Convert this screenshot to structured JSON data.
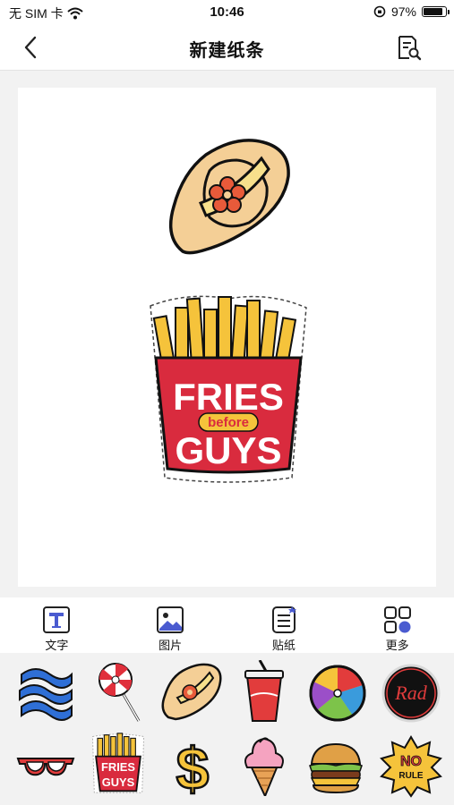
{
  "status_bar": {
    "carrier": "无 SIM 卡",
    "time": "10:46",
    "battery": "97%",
    "battery_level": 0.97
  },
  "nav": {
    "title": "新建纸条",
    "back_icon": "chevron-left-icon",
    "action_icon": "document-search-icon"
  },
  "canvas": {
    "items": [
      "hat-sticker",
      "fries-before-guys-sticker"
    ],
    "fries_text": {
      "line1": "FRIES",
      "line2": "before",
      "line3": "GUYS"
    }
  },
  "toolbar": {
    "text_label": "文字",
    "image_label": "图片",
    "sticker_label": "贴纸",
    "more_label": "更多",
    "accent": "#4a5bd0"
  },
  "stickers": {
    "row1": [
      "waves",
      "lollipop",
      "hat",
      "soda-cup",
      "beach-ball",
      "rad-badge"
    ],
    "row2": [
      "sunglasses",
      "fries",
      "dollar-sign",
      "ice-cream",
      "burger",
      "no-rule-badge"
    ],
    "rad_text": "Rad",
    "fries_text": {
      "line1": "FRIES",
      "line2": "GUYS"
    },
    "no_rule_text": {
      "line1": "NO",
      "line2": "RULE"
    }
  }
}
